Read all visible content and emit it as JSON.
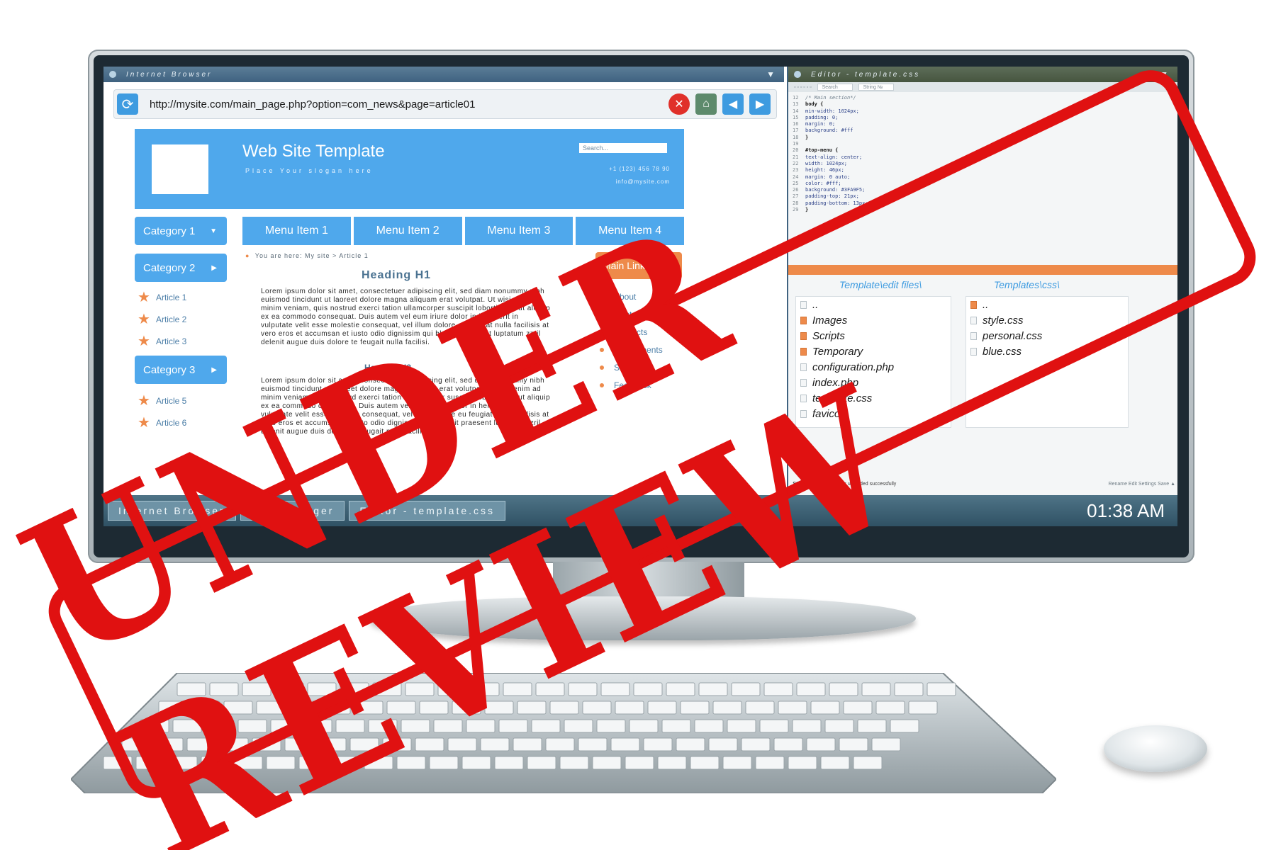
{
  "browser": {
    "window_title": "Internet Browser",
    "url": "http://mysite.com/main_page.php?option=com_news&page=article01",
    "site": {
      "title": "Web Site Template",
      "slogan": "Place Your slogan here",
      "search_placeholder": "Search...",
      "phone": "+1 (123) 456 78 90",
      "email": "info@mysite.com"
    },
    "categories": [
      {
        "label": "Category 1",
        "arrow": "▼"
      },
      {
        "label": "Category 2",
        "arrow": "▶"
      },
      {
        "label": "Category 3",
        "arrow": "▶"
      }
    ],
    "articles": [
      "Article 1",
      "Article 2",
      "Article 3",
      "Article 5",
      "Article 6"
    ],
    "menu": [
      "Menu Item 1",
      "Menu Item 2",
      "Menu Item 3",
      "Menu Item 4"
    ],
    "breadcrumb": {
      "prefix": "You are here:",
      "path": "My site > Article 1"
    },
    "heading_h1": "Heading H1",
    "heading_h2": "Heading H2",
    "paragraph_1": "Lorem ipsum dolor sit amet, consectetuer adipiscing elit, sed diam nonummy nibh euismod tincidunt ut laoreet dolore magna aliquam erat volutpat. Ut wisi enim ad minim veniam, quis nostrud exerci tation ullamcorper suscipit lobortis nisl ut aliquip ex ea commodo consequat. Duis autem vel eum iriure dolor in hendrerit in vulputate velit esse molestie consequat, vel illum dolore eu feugiat nulla facilisis at vero eros et accumsan et iusto odio dignissim qui blandit praesent luptatum zzril delenit augue duis dolore te feugait nulla facilisi.",
    "paragraph_2": "Lorem ipsum dolor sit amet, consectetuer adipiscing elit, sed diam nonummy nibh euismod tincidunt ut laoreet dolore magna aliquam erat volutpat. Ut wisi enim ad minim veniam, quis nostrud exerci tation ullamcorper suscipit lobortis nisl ut aliquip ex ea commodo consequat. Duis autem vel eum iriure dolor in hendrerit in vulputate velit esse molestie consequat, vel illum dolore eu feugiat nulla facilisis at vero eros et accumsan et iusto odio dignissim qui blandit praesent luptatum zzril delenit augue duis dolore te feugait nulla facilisi.",
    "side_menu": {
      "label": "Main Links",
      "arrow": "▶",
      "links": [
        "About",
        "Contacts",
        "Products",
        "Departments",
        "Site Map",
        "Feedback"
      ]
    }
  },
  "editor": {
    "window_title": "Editor - template.css",
    "search_placeholder": "Search",
    "string_placeholder": "String №",
    "code_lines": [
      {
        "n": "12",
        "t": "/* Main section*/",
        "k": "cmt"
      },
      {
        "n": "13",
        "t": "body {",
        "k": "sel"
      },
      {
        "n": "14",
        "t": "min-width: 1024px;",
        "k": "prop"
      },
      {
        "n": "15",
        "t": "padding: 0;",
        "k": "prop"
      },
      {
        "n": "16",
        "t": "margin: 0;",
        "k": "prop"
      },
      {
        "n": "17",
        "t": "background: #fff",
        "k": "prop"
      },
      {
        "n": "18",
        "t": "}",
        "k": "sel"
      },
      {
        "n": "19",
        "t": "",
        "k": "prop"
      },
      {
        "n": "20",
        "t": "#top-menu {",
        "k": "sel"
      },
      {
        "n": "21",
        "t": "text-align: center;",
        "k": "prop"
      },
      {
        "n": "22",
        "t": "width: 1024px;",
        "k": "prop"
      },
      {
        "n": "23",
        "t": "height: 46px;",
        "k": "prop"
      },
      {
        "n": "24",
        "t": "margin: 0 auto;",
        "k": "prop"
      },
      {
        "n": "25",
        "t": "color: #fff;",
        "k": "prop"
      },
      {
        "n": "26",
        "t": "background: #3FA9F5;",
        "k": "prop"
      },
      {
        "n": "27",
        "t": "padding-top: 21px;",
        "k": "prop"
      },
      {
        "n": "28",
        "t": "padding-bottom: 13px;",
        "k": "prop"
      },
      {
        "n": "29",
        "t": "}",
        "k": "sel"
      }
    ],
    "file_manager": {
      "left_header": "Template\\edit files\\",
      "right_header": "Templates\\css\\",
      "left_files": [
        {
          "name": "..",
          "folder": false
        },
        {
          "name": "Images",
          "folder": true
        },
        {
          "name": "Scripts",
          "folder": true
        },
        {
          "name": "Temporary",
          "folder": true
        },
        {
          "name": "configuration.php",
          "folder": false
        },
        {
          "name": "index.php",
          "folder": false
        },
        {
          "name": "template.css",
          "folder": false
        },
        {
          "name": "favicon",
          "folder": false
        }
      ],
      "right_files": [
        {
          "name": "..",
          "folder": true
        },
        {
          "name": "style.css",
          "folder": false
        },
        {
          "name": "personal.css",
          "folder": false
        },
        {
          "name": "blue.css",
          "folder": false
        }
      ]
    },
    "status_label": "Status:",
    "status_text": "file template.css uploaded successfully",
    "status_actions": "Rename    Edit                                        Settings    Save ▲"
  },
  "taskbar": {
    "items": [
      "Internet Browser",
      "File Manager",
      "Editor - template.css"
    ],
    "clock": "01:38 AM"
  },
  "stamp": {
    "text": "UNDER REVIEW",
    "color": "#e01111"
  },
  "colors": {
    "accent_blue": "#4fa8ec",
    "accent_orange": "#ee8a4a",
    "close_red": "#e0302a",
    "titlebar": "#3f6280"
  }
}
